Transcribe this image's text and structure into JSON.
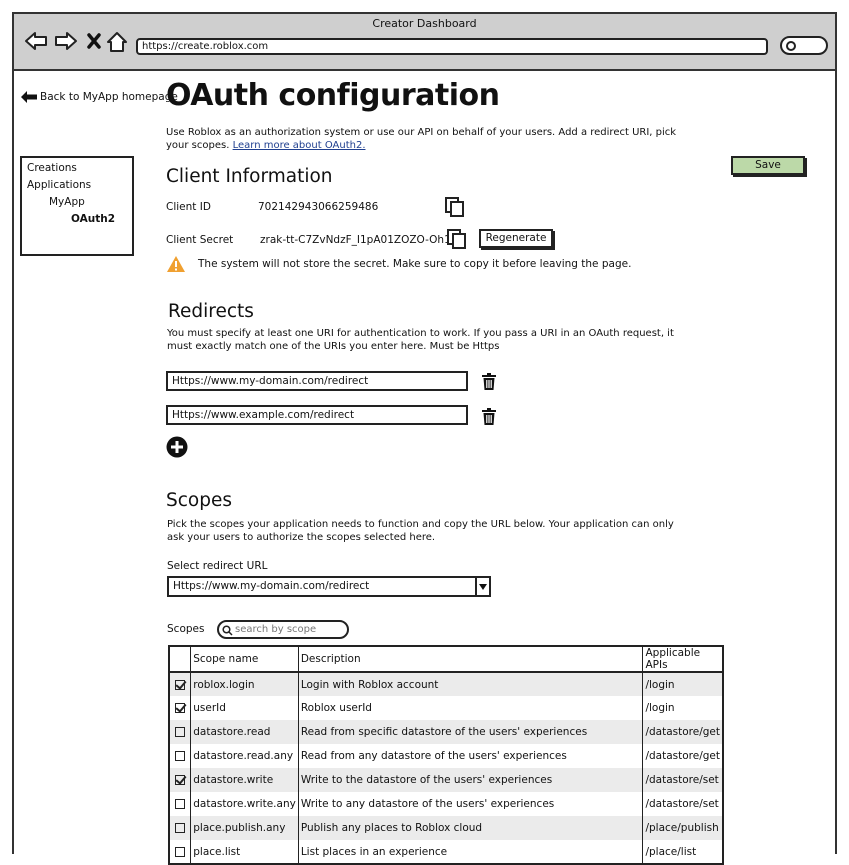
{
  "window": {
    "title": "Creator Dashboard"
  },
  "browser": {
    "url": "https://create.roblox.com"
  },
  "sidebar": {
    "back_label": "Back to MyApp homepage",
    "tree": [
      "Creations",
      "Applications",
      "MyApp",
      "OAuth2"
    ]
  },
  "page": {
    "title": "OAuth configuration",
    "intro": "Use Roblox as an authorization system or use our API on behalf of your users. Add a redirect URI, pick your scopes.",
    "learn_more": "Learn more about OAuth2.",
    "save_label": "Save"
  },
  "client": {
    "heading": "Client Information",
    "id_label": "Client ID",
    "id_value": "702142943066259486",
    "secret_label": "Client Secret",
    "secret_value": "zrak-tt-C7ZvNdzF_I1pA01ZOZO-Oh1r",
    "regenerate_label": "Regenerate",
    "warning": "The system will not store the secret. Make sure to copy it before leaving the page."
  },
  "redirects": {
    "heading": "Redirects",
    "description": "You must specify at least one URI for authentication to work. If you pass a URI in an OAuth request, it must exactly match one of the URIs you enter here. Must be Https",
    "uris": [
      "Https://www.my-domain.com/redirect",
      "Https://www.example.com/redirect"
    ]
  },
  "scopes": {
    "heading": "Scopes",
    "description": "Pick the scopes your application needs to function and copy the URL below. Your application can only ask your users to authorize the scopes selected here.",
    "select_label": "Select redirect URL",
    "selected_url": "Https://www.my-domain.com/redirect",
    "scopes_label": "Scopes",
    "search_placeholder": "search by scope",
    "columns": [
      "Scope name",
      "Description",
      "Applicable APIs"
    ],
    "rows": [
      {
        "checked": true,
        "name": "roblox.login",
        "description": "Login with Roblox account",
        "api": "/login"
      },
      {
        "checked": true,
        "name": "userId",
        "description": "Roblox userId",
        "api": "/login"
      },
      {
        "checked": false,
        "name": "datastore.read",
        "description": "Read from specific datastore of the users' experiences",
        "api": "/datastore/get"
      },
      {
        "checked": false,
        "name": "datastore.read.any",
        "description": "Read from any datastore of the users' experiences",
        "api": "/datastore/get"
      },
      {
        "checked": true,
        "name": "datastore.write",
        "description": "Write to the datastore of the users' experiences",
        "api": "/datastore/set"
      },
      {
        "checked": false,
        "name": "datastore.write.any",
        "description": "Write to any datastore of the users' experiences",
        "api": "/datastore/set"
      },
      {
        "checked": false,
        "name": "place.publish.any",
        "description": "Publish any places to Roblox cloud",
        "api": "/place/publish"
      },
      {
        "checked": false,
        "name": "place.list",
        "description": "List places in an experience",
        "api": "/place/list"
      }
    ]
  },
  "colors": {
    "save_button": "#bcd9a8",
    "warning": "#f0a030",
    "chrome": "#cfcfcf",
    "link": "#1f3f8f"
  }
}
